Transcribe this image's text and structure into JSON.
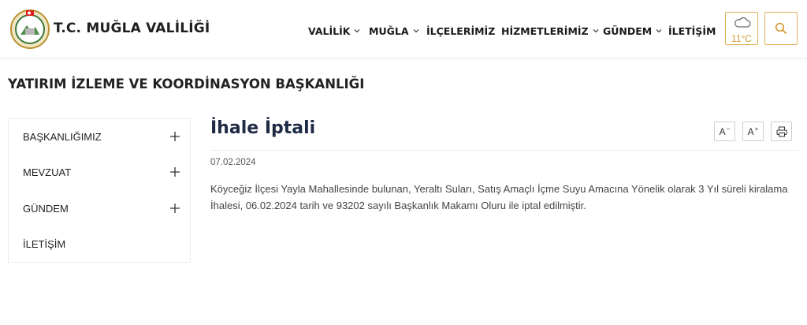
{
  "header": {
    "site_title": "T.C. MUĞLA VALİLİĞİ",
    "nav": [
      {
        "label": "VALİLİK",
        "has_dropdown": true
      },
      {
        "label": "MUĞLA",
        "has_dropdown": true
      },
      {
        "label": "İLÇELERİMİZ",
        "has_dropdown": false
      },
      {
        "label": "HİZMETLERİMİZ",
        "has_dropdown": true
      },
      {
        "label": "GÜNDEM",
        "has_dropdown": true
      },
      {
        "label": "İLETİŞİM",
        "has_dropdown": false
      }
    ],
    "weather": {
      "temperature": "11°C",
      "icon": "cloud-icon"
    },
    "search_icon": "search-icon"
  },
  "page": {
    "section_title": "YATIRIM İZLEME VE KOORDİNASYON BAŞKANLIĞI"
  },
  "sidebar": {
    "items": [
      {
        "label": "BAŞKANLIĞIMIZ",
        "expandable": true
      },
      {
        "label": "MEVZUAT",
        "expandable": true
      },
      {
        "label": "GÜNDEM",
        "expandable": true
      },
      {
        "label": "İLETİŞİM",
        "expandable": false
      }
    ]
  },
  "article": {
    "title": "İhale İptali",
    "date": "07.02.2024",
    "body": "Köyceğiz İlçesi Yayla Mahallesinde bulunan, Yeraltı Suları, Satış Amaçlı İçme Suyu Amacına Yönelik olarak 3 Yıl süreli kiralama İhalesi, 06.02.2024 tarih ve 93202 sayılı Başkanlık Makamı Oluru ile iptal edilmiştir.",
    "tools": {
      "font_decrease": "A",
      "font_decrease_mark": "−",
      "font_increase": "A",
      "font_increase_mark": "+",
      "print_icon": "print-icon"
    }
  },
  "colors": {
    "accent": "#e0b25a",
    "accent_text": "#d39a2e",
    "title": "#1f2a44"
  }
}
